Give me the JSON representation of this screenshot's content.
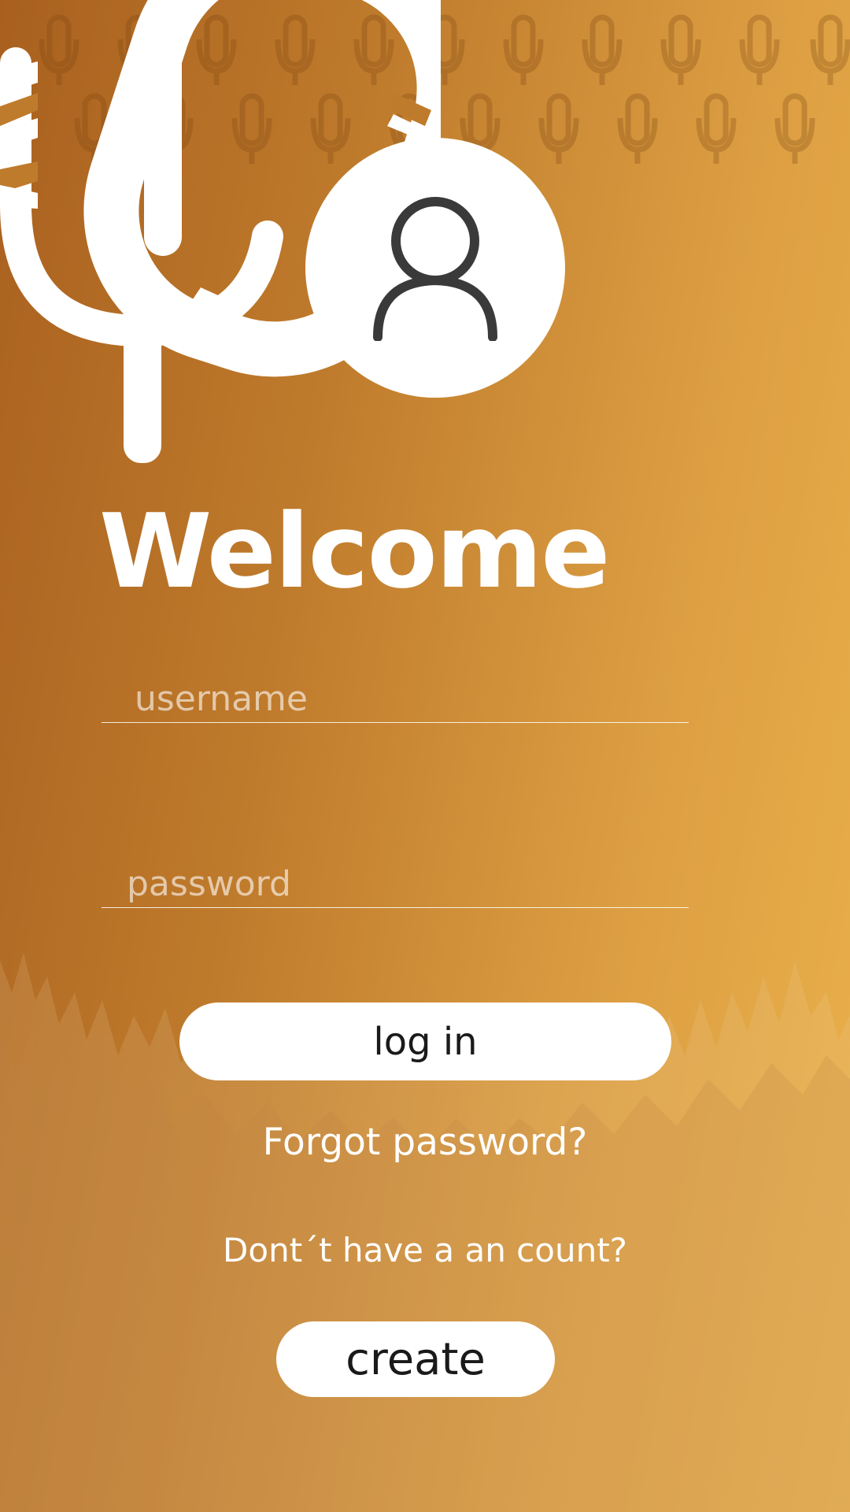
{
  "colors": {
    "gradient_start": "#a9601f",
    "gradient_end": "#ebb24c",
    "text": "#ffffff",
    "button_bg": "#ffffff",
    "button_text": "#1a1a1a",
    "avatar_icon": "#3a3a3a"
  },
  "icons": {
    "logo": "microphone-logo-icon",
    "avatar": "user-avatar-icon"
  },
  "login": {
    "title": "Welcome",
    "username_placeholder": "username",
    "username_value": "",
    "password_placeholder": "password",
    "password_value": "",
    "login_label": "log in",
    "forgot_label": "Forgot password?",
    "no_account_text": "Dont´t have a an count?",
    "create_label": "create"
  }
}
